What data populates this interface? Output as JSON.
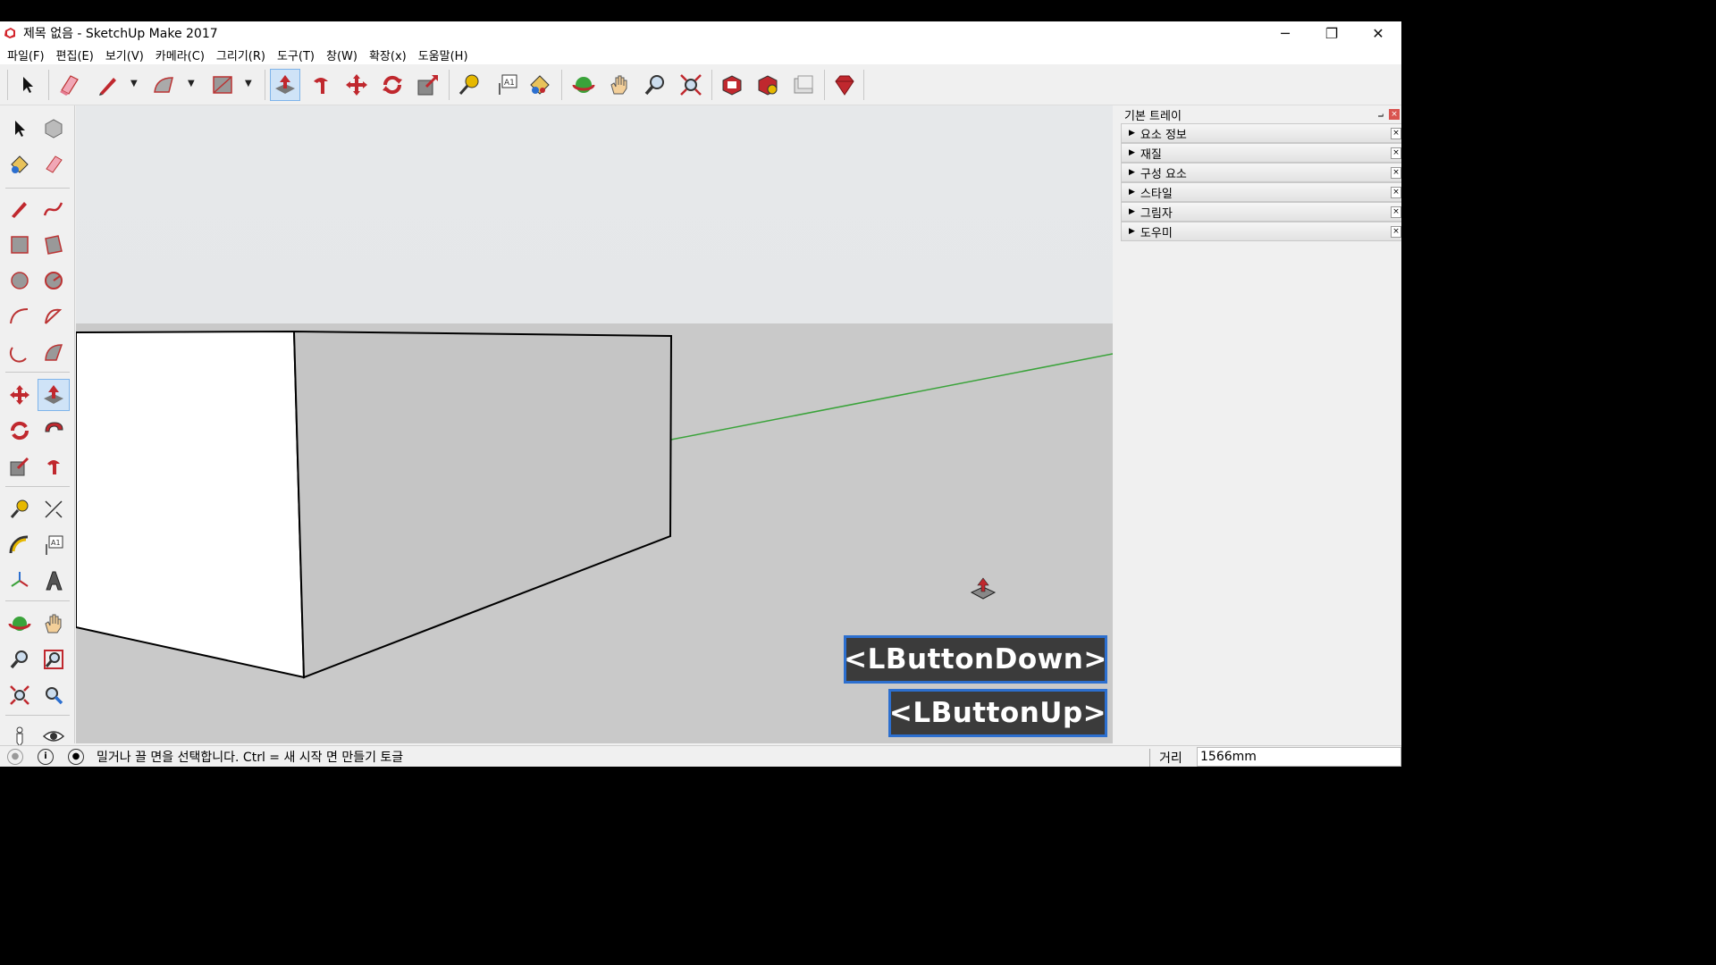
{
  "window": {
    "title": "제목 없음 - SketchUp Make 2017",
    "controls": {
      "minimize": "─",
      "restore": "❐",
      "close": "✕"
    }
  },
  "menu": [
    "파일(F)",
    "편집(E)",
    "보기(V)",
    "카메라(C)",
    "그리기(R)",
    "도구(T)",
    "창(W)",
    "확장(x)",
    "도움말(H)"
  ],
  "toolbar": {
    "tools": [
      "select",
      "eraser",
      "pencil",
      "arc",
      "rectangle",
      "push-pull",
      "follow-me",
      "move",
      "rotate",
      "scale",
      "tape-measure",
      "text",
      "paint-bucket",
      "orbit",
      "pan",
      "zoom",
      "zoom-extents",
      "3d-warehouse",
      "extension-warehouse",
      "layout",
      "extension-ruby"
    ],
    "active_tool": "push-pull"
  },
  "left_palette": {
    "active_tool": "push-pull"
  },
  "tray": {
    "title": "기본 트레이",
    "pin": "📌",
    "close": "×",
    "panels": [
      "요소 정보",
      "재질",
      "구성 요소",
      "스타일",
      "그림자",
      "도우미"
    ]
  },
  "status": {
    "hint": "밀거나 끌 면을 선택합니다.  Ctrl = 새 시작 면 만들기 토글",
    "vcb_label": "거리",
    "vcb_value": "1566mm"
  },
  "overlays": {
    "key1": "<LButtonDown>",
    "key2": "<LButtonUp>"
  },
  "colors": {
    "accent": "#7eb4ea",
    "keybox_border": "#2c6fcf",
    "green_axis": "#3aa33a"
  }
}
